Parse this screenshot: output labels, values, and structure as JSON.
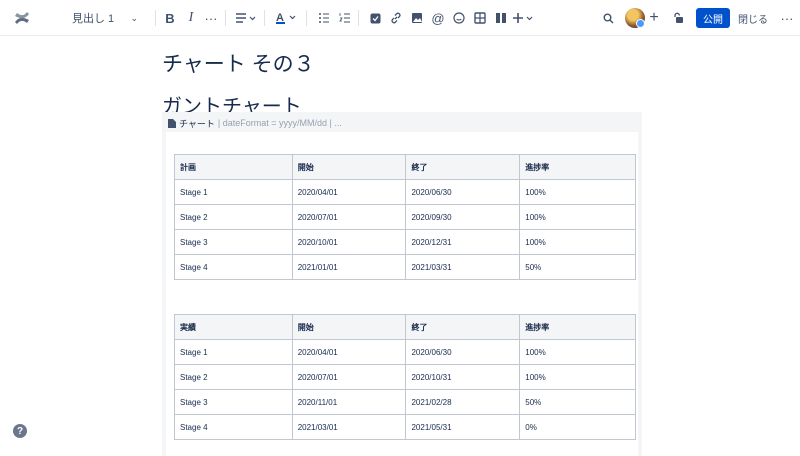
{
  "toolbar": {
    "heading_select": "見出し 1",
    "publish_label": "公開",
    "close_label": "閉じる"
  },
  "page": {
    "title": "チャート その３",
    "heading": "ガントチャート"
  },
  "macro": {
    "name": "チャート",
    "params": "| dateFormat = yyyy/MM/dd | ..."
  },
  "plan_table": {
    "headers": [
      "計画",
      "開始",
      "終了",
      "進捗率"
    ],
    "rows": [
      [
        "Stage 1",
        "2020/04/01",
        "2020/06/30",
        "100%"
      ],
      [
        "Stage 2",
        "2020/07/01",
        "2020/09/30",
        "100%"
      ],
      [
        "Stage 3",
        "2020/10/01",
        "2020/12/31",
        "100%"
      ],
      [
        "Stage 4",
        "2021/01/01",
        "2021/03/31",
        "50%"
      ]
    ]
  },
  "actual_table": {
    "headers": [
      "実績",
      "開始",
      "終了",
      "進捗率"
    ],
    "rows": [
      [
        "Stage 1",
        "2020/04/01",
        "2020/06/30",
        "100%"
      ],
      [
        "Stage 2",
        "2020/07/01",
        "2020/10/31",
        "100%"
      ],
      [
        "Stage 3",
        "2020/11/01",
        "2021/02/28",
        "50%"
      ],
      [
        "Stage 4",
        "2021/03/01",
        "2021/05/31",
        "0%"
      ]
    ]
  },
  "help_label": "?"
}
